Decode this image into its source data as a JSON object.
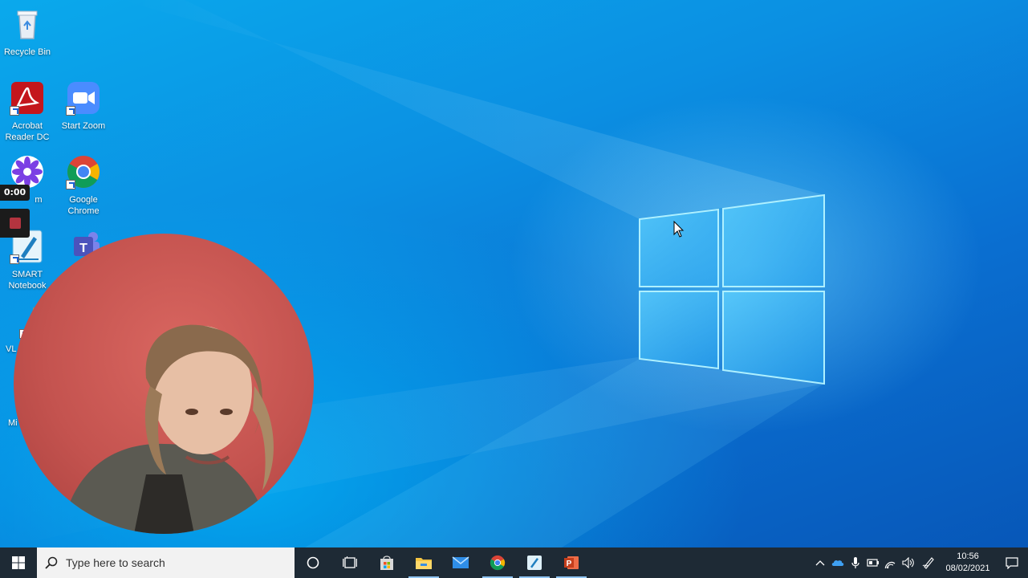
{
  "desktop": {
    "icons": [
      {
        "label": "Recycle Bin"
      },
      {
        "label": "Acrobat Reader DC"
      },
      {
        "label": "Start Zoom"
      },
      {
        "label": "m"
      },
      {
        "label": "Google Chrome"
      },
      {
        "label": "SMART Notebook"
      },
      {
        "label": "VL"
      },
      {
        "label": "Mi E"
      }
    ]
  },
  "recorder": {
    "timer": "0:00"
  },
  "taskbar": {
    "search_placeholder": "Type here to search",
    "clock_time": "10:56",
    "clock_date": "08/02/2021"
  },
  "colors": {
    "taskbar_bg": "#1e2a35",
    "accent": "#0a78d7"
  }
}
